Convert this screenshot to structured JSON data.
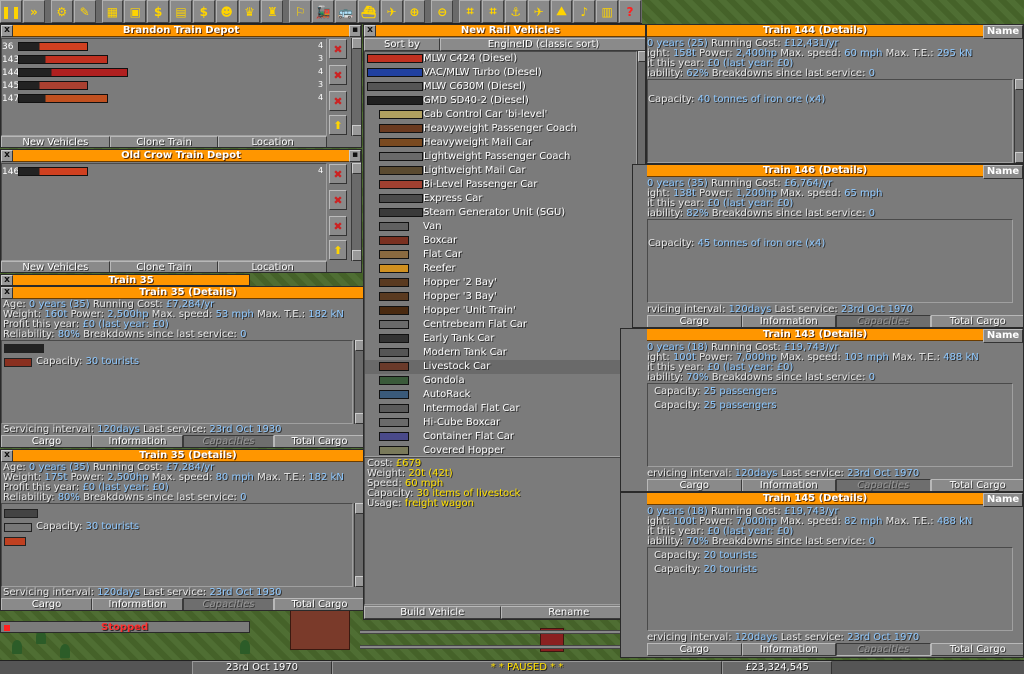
{
  "colors": {
    "titlebar": "#ff9600",
    "value": "#8ec8ff",
    "highlight": "#ffe000",
    "stopped": "#ff3030"
  },
  "toolbar": {
    "icons": [
      "pause-icon",
      "fast-forward-icon",
      "settings-icon",
      "save-icon",
      "map-icon",
      "town-directory-icon",
      "subsidies-icon",
      "station-list-icon",
      "finances-icon",
      "company-icon",
      "graphs-icon",
      "league-icon",
      "industry-icon",
      "train-list-icon",
      "road-vehicle-list-icon",
      "ship-list-icon",
      "aircraft-list-icon",
      "zoom-in-icon",
      "zoom-out-icon",
      "build-rail-icon",
      "build-road-icon",
      "build-dock-icon",
      "build-airport-icon",
      "landscaping-icon",
      "music-icon",
      "news-icon",
      "help-icon"
    ],
    "glyphs": [
      "❚❚",
      "»",
      "⚙",
      "✎",
      "▦",
      "▣",
      "$",
      "▤",
      "$",
      "☻",
      "♛",
      "♜",
      "⚐",
      "🚂",
      "🚌",
      "⛴",
      "✈",
      "⊕",
      "⊖",
      "⌗",
      "⌗",
      "⚓",
      "✈",
      "⛰",
      "♪",
      "▥",
      "?"
    ]
  },
  "brandon_depot": {
    "title": "Brandon Train Depot",
    "rows": [
      {
        "num": "36",
        "count": "4"
      },
      {
        "num": "143",
        "count": "3"
      },
      {
        "num": "144",
        "count": "4"
      },
      {
        "num": "145",
        "count": "3"
      },
      {
        "num": "147",
        "count": "4"
      }
    ],
    "buttons": [
      "New Vehicles",
      "Clone Train",
      "Location"
    ]
  },
  "oldcrow_depot": {
    "title": "Old Crow Train Depot",
    "rows": [
      {
        "num": "146",
        "count": "4"
      }
    ],
    "buttons": [
      "New Vehicles",
      "Clone Train",
      "Location"
    ]
  },
  "train35_small": {
    "title": "Train 35",
    "status": "Stopped"
  },
  "train35_a": {
    "title": "Train 35 (Details)",
    "age_label": "Age:",
    "age": "0 years (35)",
    "cost_label": "Running Cost:",
    "cost": "£7,284/yr",
    "weight_label": "Weight:",
    "weight": "160t",
    "power_label": "Power:",
    "power": "2,500hp",
    "speed_label": "Max. speed:",
    "speed": "53 mph",
    "te_label": "Max. T.E.:",
    "te": "182 kN",
    "profit_label": "Profit this year:",
    "profit": "£0 (last year: £0)",
    "rel_label": "Reliability:",
    "rel": "80%",
    "bd_label": "Breakdowns since last service:",
    "bd": "0",
    "capacity_label": "Capacity:",
    "capacity": "30 tourists",
    "service_label": "Servicing interval:",
    "service": "120days",
    "last_label": "Last service:",
    "last": "23rd Oct 1930",
    "tabs": [
      "Cargo",
      "Information",
      "Capacities",
      "Total Cargo"
    ]
  },
  "train35_b": {
    "title": "Train 35 (Details)",
    "age": "0 years (35)",
    "cost": "£7,284/yr",
    "weight": "175t",
    "power": "2,500hp",
    "speed": "80 mph",
    "te": "182 kN",
    "profit": "£0 (last year: £0)",
    "rel": "80%",
    "bd": "0",
    "capacity": "30 tourists",
    "service": "120days",
    "last": "23rd Oct 1930",
    "tabs": [
      "Cargo",
      "Information",
      "Capacities",
      "Total Cargo"
    ]
  },
  "new_vehicles": {
    "title": "New Rail Vehicles",
    "sort_label": "Sort by",
    "sort_value": "EngineID (classic sort)",
    "items": [
      "MLW C424 (Diesel)",
      "VAC/MLW Turbo (Diesel)",
      "MLW C630M (Diesel)",
      "GMD SD40-2 (Diesel)",
      "Cab Control Car 'bi-level'",
      "Heavyweight Passenger Coach",
      "Heavyweight Mail Car",
      "Lightweight Passenger Coach",
      "Lightweight Mail Car",
      "Bi-Level Passenger Car",
      "Express Car",
      "Steam Generator Unit (SGU)",
      "Van",
      "Boxcar",
      "Flat Car",
      "Reefer",
      "Hopper '2 Bay'",
      "Hopper '3 Bay'",
      "Hopper 'Unit Train'",
      "Centrebeam Flat Car",
      "Early Tank Car",
      "Modern Tank Car",
      "Livestock Car",
      "Gondola",
      "AutoRack",
      "Intermodal Flat Car",
      "Hi-Cube Boxcar",
      "Container Flat Car",
      "Covered Hopper"
    ],
    "selected_index": 22,
    "info": {
      "cost_label": "Cost:",
      "cost": "£679",
      "weight_label": "Weight:",
      "weight": "20t (42t)",
      "speed_label": "Speed:",
      "speed": "60 mph",
      "capacity_label": "Capacity:",
      "capacity": "30 items of livestock",
      "usage_label": "Usage:",
      "usage": "freight wagon"
    },
    "buttons": [
      "Build Vehicle",
      "Rename"
    ]
  },
  "train144": {
    "title": "Train 144 (Details)",
    "name_btn": "Name",
    "l1": "0 years (25)",
    "cost_label": "Running Cost:",
    "cost": "£12,431/yr",
    "weight": "158t",
    "power_label": "Power:",
    "power": "2,400hp",
    "speed_label": "Max. speed:",
    "speed": "60 mph",
    "te_label": "Max. T.E.:",
    "te": "295 kN",
    "profit_label": "it this year:",
    "profit": "£0 (last year: £0)",
    "rel_label": "iability:",
    "rel": "62%",
    "bd_label": "Breakdowns since last service:",
    "bd": "0",
    "capacity_label": "Capacity:",
    "capacity": "40 tonnes of iron ore (x4)"
  },
  "train146": {
    "title": "Train 146 (Details)",
    "name_btn": "Name",
    "l1": "0 years (35)",
    "cost": "£6,764/yr",
    "weight": "138t",
    "power": "1,200hp",
    "speed": "65 mph",
    "profit": "£0 (last year: £0)",
    "rel": "82%",
    "bd": "0",
    "capacity": "45 tonnes of iron ore (x4)",
    "service_label": "rvicing interval:",
    "service": "120days",
    "last_label": "Last service:",
    "last": "23rd Oct 1970",
    "tabs": [
      "Cargo",
      "Information",
      "Capacities",
      "Total Cargo"
    ]
  },
  "train143": {
    "title": "Train 143 (Details)",
    "name_btn": "Name",
    "l1": "0 years (18)",
    "cost": "£19,743/yr",
    "weight": "100t",
    "power": "7,000hp",
    "speed": "103 mph",
    "te": "488 kN",
    "profit": "£0 (last year: £0)",
    "rel": "70%",
    "bd": "0",
    "capacity1": "25 passengers",
    "capacity2": "25 passengers",
    "service_label": "ervicing interval:",
    "service": "120days",
    "last": "23rd Oct 1970",
    "tabs": [
      "Cargo",
      "Information",
      "Capacities",
      "Total Cargo"
    ]
  },
  "train145": {
    "title": "Train 145 (Details)",
    "name_btn": "Name",
    "l1": "0 years (18)",
    "cost": "£19,743/yr",
    "weight": "100t",
    "power": "7,000hp",
    "speed": "82 mph",
    "te": "488 kN",
    "profit": "£0 (last year: £0)",
    "rel": "70%",
    "bd": "0",
    "capacity1": "20 tourists",
    "capacity2": "20 tourists",
    "service_label": "ervicing interval:",
    "service": "120days",
    "last": "23rd Oct 1970",
    "tabs": [
      "Cargo",
      "Information",
      "Capacities",
      "Total Cargo"
    ]
  },
  "statusbar": {
    "date": "23rd Oct 1970",
    "message": "* * PAUSED * *",
    "money": "£23,324,545"
  }
}
